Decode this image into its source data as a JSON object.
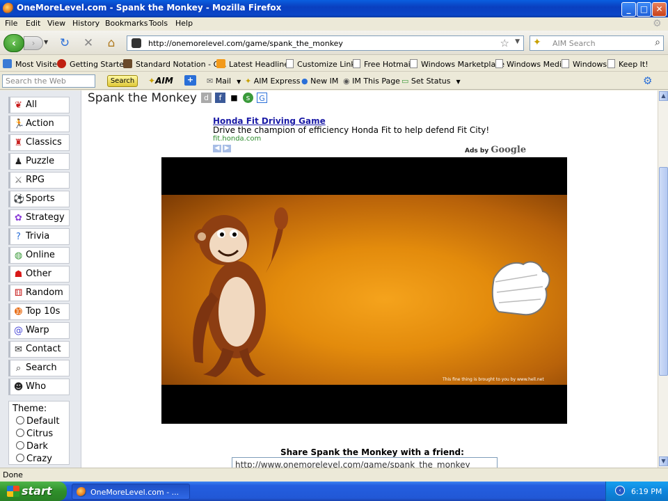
{
  "window": {
    "title": "OneMoreLevel.com - Spank the Monkey - Mozilla Firefox",
    "controls": {
      "minimize": "_",
      "maximize": "□",
      "close": "✕"
    }
  },
  "menu": [
    "File",
    "Edit",
    "View",
    "History",
    "Bookmarks",
    "Tools",
    "Help"
  ],
  "navbar": {
    "url": "http://onemorelevel.com/game/spank_the_monkey",
    "search_placeholder": "AIM Search"
  },
  "bookmarks": [
    {
      "label": "Most Visited",
      "icon": "globe-icon"
    },
    {
      "label": "Getting Started",
      "icon": "firefox-icon"
    },
    {
      "label": "Standard Notation - G...",
      "icon": "picture-icon"
    },
    {
      "label": "Latest Headlines",
      "icon": "rss-icon"
    },
    {
      "label": "Customize Links",
      "icon": "page-icon"
    },
    {
      "label": "Free Hotmail",
      "icon": "page-icon"
    },
    {
      "label": "Windows Marketplace",
      "icon": "page-icon"
    },
    {
      "label": "Windows Media",
      "icon": "page-icon"
    },
    {
      "label": "Windows",
      "icon": "page-icon"
    },
    {
      "label": "Keep It!",
      "icon": "page-icon"
    }
  ],
  "aimbar": {
    "search_placeholder": "Search the Web",
    "search_button": "Search",
    "aim_label": "AIM",
    "items": [
      "Mail",
      "AIM Express",
      "New IM",
      "IM This Page",
      "Set Status"
    ]
  },
  "sidebar": {
    "items": [
      {
        "label": "All",
        "icon": "cherries-icon"
      },
      {
        "label": "Action",
        "icon": "runner-icon"
      },
      {
        "label": "Classics",
        "icon": "mario-icon"
      },
      {
        "label": "Puzzle",
        "icon": "chess-pawn-icon"
      },
      {
        "label": "RPG",
        "icon": "sword-icon"
      },
      {
        "label": "Sports",
        "icon": "soccer-ball-icon"
      },
      {
        "label": "Strategy",
        "icon": "color-wheel-icon"
      },
      {
        "label": "Trivia",
        "icon": "question-icon"
      },
      {
        "label": "Online",
        "icon": "globe-icon"
      },
      {
        "label": "Other",
        "icon": "ghost-icon"
      },
      {
        "label": "Random",
        "icon": "dice-icon"
      },
      {
        "label": "Top 10s",
        "icon": "top10-icon"
      },
      {
        "label": "Warp",
        "icon": "spiral-icon"
      },
      {
        "label": "Contact",
        "icon": "envelope-icon"
      },
      {
        "label": "Search",
        "icon": "magnifier-icon"
      },
      {
        "label": "Who",
        "icon": "person-icon"
      }
    ],
    "theme": {
      "label": "Theme:",
      "options": [
        "Default",
        "Citrus",
        "Dark",
        "Crazy"
      ]
    }
  },
  "main": {
    "page_title": "Spank the Monkey",
    "ad": {
      "title": "Honda Fit Driving Game",
      "text": "Drive the champion of efficiency Honda Fit to help defend Fit City!",
      "url": "fit.honda.com",
      "ads_by": "Ads by",
      "google": "Google"
    },
    "game_credit": "This fine thing is brought to you by www.hell.net",
    "share_label": "Share Spank the Monkey with a friend:",
    "share_url": "http://www.onemorelevel.com/game/spank_the_monkey"
  },
  "status": "Done",
  "taskbar": {
    "start": "start",
    "item": "OneMoreLevel.com - ...",
    "clock": "6:19 PM"
  },
  "colors": {
    "accent_link": "#1a1aa6",
    "game_bg": "#e38b0c",
    "taskbar_blue": "#245ee0"
  }
}
